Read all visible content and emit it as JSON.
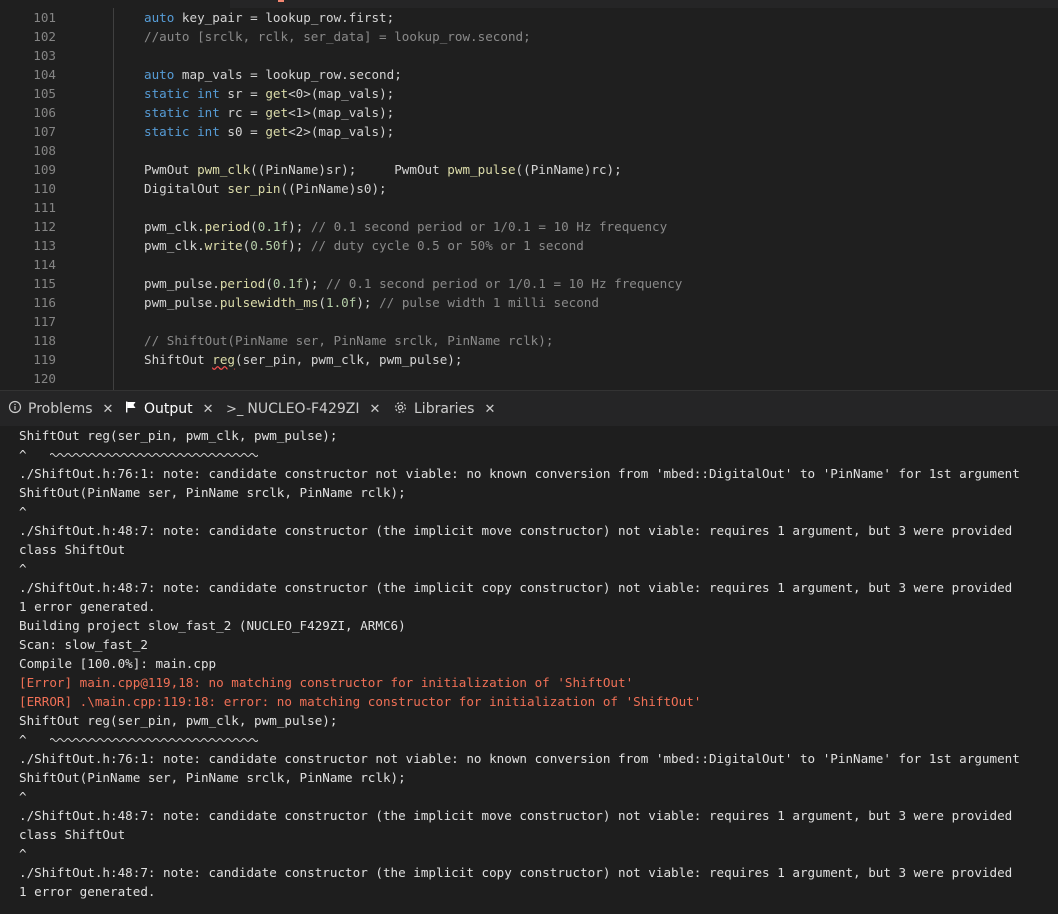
{
  "editor": {
    "line_numbers": [
      "101",
      "102",
      "103",
      "104",
      "105",
      "106",
      "107",
      "108",
      "109",
      "110",
      "111",
      "112",
      "113",
      "114",
      "115",
      "116",
      "117",
      "118",
      "119",
      "120"
    ]
  },
  "code": {
    "l101": [
      "auto",
      " key_pair = lookup_row.first;"
    ],
    "l102": "//auto [srclk, rclk, ser_data] = lookup_row.second;",
    "l104": [
      "auto",
      " map_vals = lookup_row.second;"
    ],
    "l105": [
      "static",
      " ",
      "int",
      " sr = ",
      "get",
      "<0>(map_vals);"
    ],
    "l106": [
      "static",
      " ",
      "int",
      " rc = ",
      "get",
      "<1>(map_vals);"
    ],
    "l107": [
      "static",
      " ",
      "int",
      " s0 = ",
      "get",
      "<2>(map_vals);"
    ],
    "l109": [
      "PwmOut ",
      "pwm_clk",
      "((PinName)sr);     PwmOut ",
      "pwm_pulse",
      "((PinName)rc);"
    ],
    "l110": [
      "DigitalOut ",
      "ser_pin",
      "((PinName)s0);"
    ],
    "l112": [
      "pwm_clk.",
      "period",
      "(",
      "0.1f",
      "); ",
      "// 0.1 second period or 1/0.1 = 10 Hz frequency"
    ],
    "l113": [
      "pwm_clk.",
      "write",
      "(",
      "0.50f",
      "); ",
      "// duty cycle 0.5 or 50% or 1 second"
    ],
    "l115": [
      "pwm_pulse.",
      "period",
      "(",
      "0.1f",
      "); ",
      "// 0.1 second period or 1/0.1 = 10 Hz frequency"
    ],
    "l116": [
      "pwm_pulse.",
      "pulsewidth_ms",
      "(",
      "1.0f",
      "); ",
      "// pulse width 1 milli second"
    ],
    "l118": "// ShiftOut(PinName ser, PinName srclk, PinName rclk);",
    "l119": [
      "ShiftOut ",
      "reg",
      "(ser_pin, pwm_clk, pwm_pulse);"
    ]
  },
  "panel": {
    "tabs": [
      {
        "label": "Problems",
        "icon": "info-icon"
      },
      {
        "label": "Output",
        "icon": "flag-icon"
      },
      {
        "label": "NUCLEO-F429ZI",
        "icon": "terminal-icon"
      },
      {
        "label": "Libraries",
        "icon": "gear-icon"
      }
    ],
    "active_tab": "Output"
  },
  "output": {
    "lines": [
      {
        "text": "ShiftOut reg(ser_pin, pwm_clk, pwm_pulse);",
        "type": "normal"
      },
      {
        "text": "^",
        "type": "caret"
      },
      {
        "text": "./ShiftOut.h:76:1: note: candidate constructor not viable: no known conversion from 'mbed::DigitalOut' to 'PinName' for 1st argument",
        "type": "normal"
      },
      {
        "text": "ShiftOut(PinName ser, PinName srclk, PinName rclk);",
        "type": "normal"
      },
      {
        "text": "^",
        "type": "normal"
      },
      {
        "text": "./ShiftOut.h:48:7: note: candidate constructor (the implicit move constructor) not viable: requires 1 argument, but 3 were provided",
        "type": "normal"
      },
      {
        "text": "class ShiftOut",
        "type": "normal"
      },
      {
        "text": "^",
        "type": "normal"
      },
      {
        "text": "./ShiftOut.h:48:7: note: candidate constructor (the implicit copy constructor) not viable: requires 1 argument, but 3 were provided",
        "type": "normal"
      },
      {
        "text": "1 error generated.",
        "type": "normal"
      },
      {
        "text": "Building project slow_fast_2 (NUCLEO_F429ZI, ARMC6)",
        "type": "normal"
      },
      {
        "text": "Scan: slow_fast_2",
        "type": "normal"
      },
      {
        "text": "Compile [100.0%]: main.cpp",
        "type": "normal"
      },
      {
        "text": "[Error] main.cpp@119,18: no matching constructor for initialization of 'ShiftOut'",
        "type": "error"
      },
      {
        "text": "[ERROR] .\\main.cpp:119:18: error: no matching constructor for initialization of 'ShiftOut'",
        "type": "error"
      },
      {
        "text": "ShiftOut reg(ser_pin, pwm_clk, pwm_pulse);",
        "type": "normal"
      },
      {
        "text": "^",
        "type": "caret"
      },
      {
        "text": "./ShiftOut.h:76:1: note: candidate constructor not viable: no known conversion from 'mbed::DigitalOut' to 'PinName' for 1st argument",
        "type": "normal"
      },
      {
        "text": "ShiftOut(PinName ser, PinName srclk, PinName rclk);",
        "type": "normal"
      },
      {
        "text": "^",
        "type": "normal"
      },
      {
        "text": "./ShiftOut.h:48:7: note: candidate constructor (the implicit move constructor) not viable: requires 1 argument, but 3 were provided",
        "type": "normal"
      },
      {
        "text": "class ShiftOut",
        "type": "normal"
      },
      {
        "text": "^",
        "type": "normal"
      },
      {
        "text": "./ShiftOut.h:48:7: note: candidate constructor (the implicit copy constructor) not viable: requires 1 argument, but 3 were provided",
        "type": "normal"
      },
      {
        "text": "1 error generated.",
        "type": "normal"
      }
    ]
  },
  "colors": {
    "keyword": "#569cd6",
    "function": "#dcdcaa",
    "number": "#b5cea8",
    "error": "#f07056",
    "comment": "#8a8a8a"
  }
}
